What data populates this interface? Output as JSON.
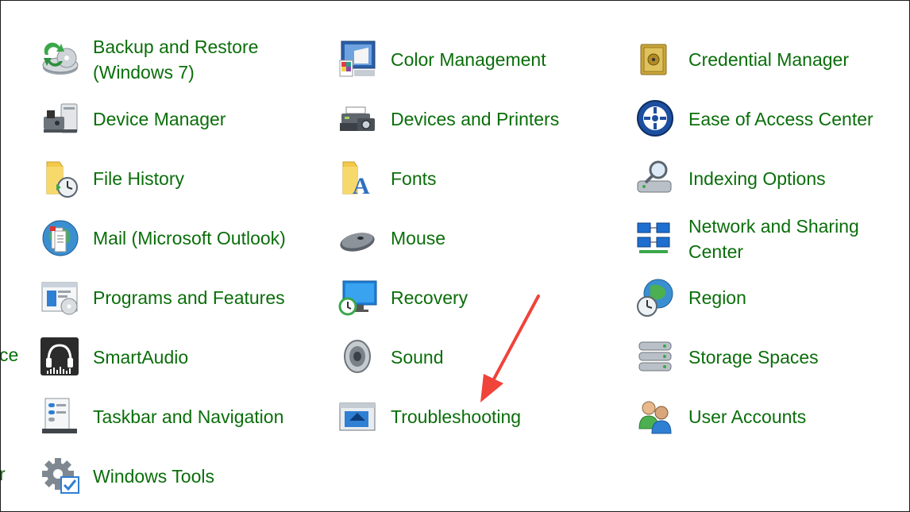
{
  "cutoff_left": [
    "ce",
    "r"
  ],
  "columns": [
    {
      "items": [
        {
          "name": "backup-and-restore",
          "label": "Backup and Restore (Windows 7)",
          "icon": "backup-icon"
        },
        {
          "name": "device-manager",
          "label": "Device Manager",
          "icon": "device-manager-icon"
        },
        {
          "name": "file-history",
          "label": "File History",
          "icon": "file-history-icon"
        },
        {
          "name": "mail",
          "label": "Mail (Microsoft Outlook)",
          "icon": "mail-icon"
        },
        {
          "name": "programs-and-features",
          "label": "Programs and Features",
          "icon": "programs-icon"
        },
        {
          "name": "smartaudio",
          "label": "SmartAudio",
          "icon": "headphones-icon"
        },
        {
          "name": "taskbar-and-navigation",
          "label": "Taskbar and Navigation",
          "icon": "taskbar-icon"
        },
        {
          "name": "windows-tools",
          "label": "Windows Tools",
          "icon": "tools-gear-icon"
        }
      ]
    },
    {
      "items": [
        {
          "name": "color-management",
          "label": "Color Management",
          "icon": "color-management-icon"
        },
        {
          "name": "devices-and-printers",
          "label": "Devices and Printers",
          "icon": "printer-icon"
        },
        {
          "name": "fonts",
          "label": "Fonts",
          "icon": "fonts-icon"
        },
        {
          "name": "mouse",
          "label": "Mouse",
          "icon": "mouse-icon"
        },
        {
          "name": "recovery",
          "label": "Recovery",
          "icon": "recovery-icon"
        },
        {
          "name": "sound",
          "label": "Sound",
          "icon": "speaker-icon"
        },
        {
          "name": "troubleshooting",
          "label": "Troubleshooting",
          "icon": "troubleshooting-icon"
        }
      ]
    },
    {
      "items": [
        {
          "name": "credential-manager",
          "label": "Credential Manager",
          "icon": "safe-icon"
        },
        {
          "name": "ease-of-access-center",
          "label": "Ease of Access Center",
          "icon": "ease-of-access-icon"
        },
        {
          "name": "indexing-options",
          "label": "Indexing Options",
          "icon": "indexing-icon"
        },
        {
          "name": "network-and-sharing-center",
          "label": "Network and Sharing Center",
          "icon": "network-icon"
        },
        {
          "name": "region",
          "label": "Region",
          "icon": "globe-clock-icon"
        },
        {
          "name": "storage-spaces",
          "label": "Storage Spaces",
          "icon": "storage-icon"
        },
        {
          "name": "user-accounts",
          "label": "User Accounts",
          "icon": "users-icon"
        }
      ]
    }
  ],
  "colors": {
    "link": "#0a6e0a",
    "annotation_arrow": "#f0433a",
    "background": "#ffffff"
  }
}
